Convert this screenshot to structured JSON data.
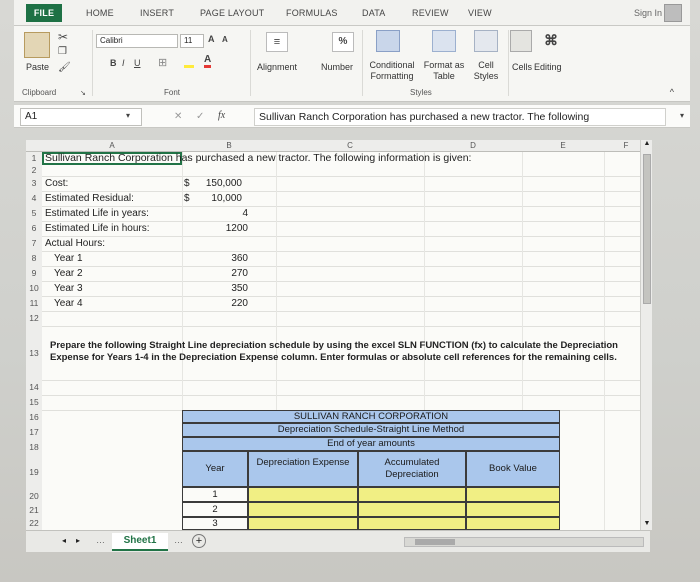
{
  "ribbon_tabs": [
    "FILE",
    "HOME",
    "INSERT",
    "PAGE LAYOUT",
    "FORMULAS",
    "DATA",
    "REVIEW",
    "VIEW"
  ],
  "sign_in": "Sign In",
  "ribbon": {
    "paste": "Paste",
    "clipboard": "Clipboard",
    "font_name": "Calibri",
    "font_size": "11",
    "font_group": "Font",
    "alignment": "Alignment",
    "number": "Number",
    "percent": "%",
    "conditional_formatting": "Conditional Formatting",
    "format_as_table": "Format as Table",
    "cell_styles": "Cell Styles",
    "styles_group": "Styles",
    "cells": "Cells",
    "editing": "Editing"
  },
  "formula_bar": {
    "name_box": "A1",
    "fx": "fx",
    "content": "Sullivan Ranch Corporation has purchased a new tractor. The following"
  },
  "columns": [
    "A",
    "B",
    "C",
    "D",
    "E",
    "F"
  ],
  "rows": {
    "r1": "Sullivan Ranch Corporation has purchased a new tractor. The following information is given:",
    "r3_label": "Cost:",
    "r3_cur": "$",
    "r3_val": "150,000",
    "r4_label": "Estimated Residual:",
    "r4_cur": "$",
    "r4_val": "10,000",
    "r5_label": "Estimated Life in years:",
    "r5_val": "4",
    "r6_label": "Estimated Life in hours:",
    "r6_val": "1200",
    "r7_label": "Actual Hours:",
    "r8_label": "Year 1",
    "r8_val": "360",
    "r9_label": "Year 2",
    "r9_val": "270",
    "r10_label": "Year 3",
    "r10_val": "350",
    "r11_label": "Year 4",
    "r11_val": "220",
    "r13_text": "Prepare the following Straight Line depreciation schedule by using the excel SLN FUNCTION (fx) to calculate the Depreciation Expense for Years 1-4 in the Depreciation Expense column. Enter formulas or absolute cell references for the remaining cells."
  },
  "table": {
    "title1": "SULLIVAN RANCH CORPORATION",
    "title2": "Depreciation Schedule-Straight Line Method",
    "title3": "End of year amounts",
    "h_year": "Year",
    "h_dep_exp": "Depreciation Expense",
    "h_acc_dep": "Accumulated Depreciation",
    "h_book": "Book Value",
    "years": [
      "1",
      "2",
      "3"
    ]
  },
  "sheet_tab": "Sheet1",
  "row_numbers": [
    "1",
    "2",
    "3",
    "4",
    "5",
    "6",
    "7",
    "8",
    "9",
    "10",
    "11",
    "12",
    "13",
    "14",
    "15",
    "16",
    "17",
    "18",
    "19",
    "20",
    "21",
    "22"
  ]
}
